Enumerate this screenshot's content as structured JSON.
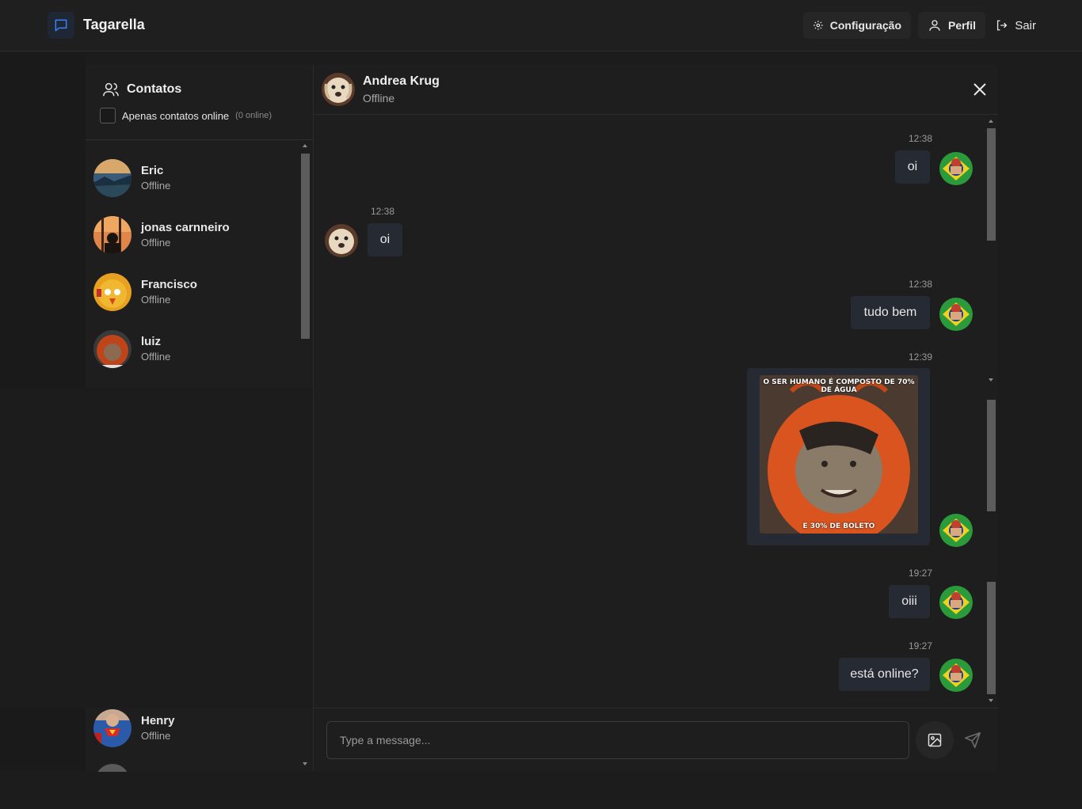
{
  "app": {
    "title": "Tagarella"
  },
  "header": {
    "config_label": "Configuração",
    "profile_label": "Perfil",
    "logout_label": "Sair"
  },
  "contacts": {
    "title": "Contatos",
    "filter_label": "Apenas contatos online",
    "filter_count": "(0 online)",
    "items": [
      {
        "name": "Eric",
        "status": "Offline"
      },
      {
        "name": "jonas carnneiro",
        "status": "Offline"
      },
      {
        "name": "Francisco",
        "status": "Offline"
      },
      {
        "name": "luiz",
        "status": "Offline"
      },
      {
        "name": "Henry",
        "status": "Offline"
      }
    ]
  },
  "chat": {
    "name": "Andrea Krug",
    "status": "Offline",
    "messages": [
      {
        "time": "12:38",
        "text": "oi",
        "side": "right"
      },
      {
        "time": "12:38",
        "text": "oi",
        "side": "left"
      },
      {
        "time": "12:38",
        "text": "tudo bem",
        "side": "right"
      },
      {
        "time": "12:39",
        "image_caption_top": "O SER HUMANO É COMPOSTO DE 70% DE ÁGUA",
        "image_caption_bottom": "E 30% DE BOLETO",
        "side": "right"
      },
      {
        "time": "19:27",
        "text": "oiii",
        "side": "right"
      },
      {
        "time": "19:27",
        "text": "está online?",
        "side": "right"
      }
    ],
    "input_placeholder": "Type a message..."
  },
  "colors": {
    "accent": "#3b82f6",
    "background": "#1c1c1c",
    "bubble": "#262a33",
    "meme_orange": "#d9541e"
  }
}
